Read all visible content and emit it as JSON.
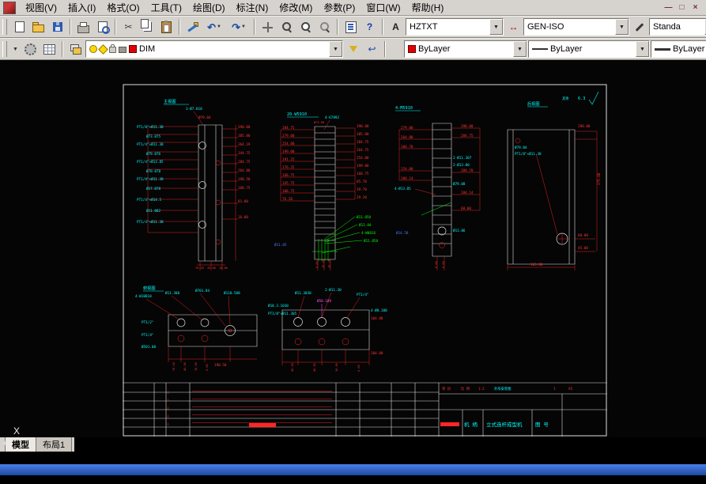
{
  "window": {
    "min": "—",
    "restore": "□",
    "close": "×"
  },
  "menu": {
    "items": [
      "视图(V)",
      "插入(I)",
      "格式(O)",
      "工具(T)",
      "绘图(D)",
      "标注(N)",
      "修改(M)",
      "参数(P)",
      "窗口(W)",
      "帮助(H)"
    ]
  },
  "icons": {
    "cut": "✂",
    "undo": "↶",
    "redo": "↷",
    "help": "?",
    "text_style": "A",
    "dim_style": "↔",
    "arrow_down": "▼",
    "overflow": "▼",
    "layer_prev": "↩"
  },
  "toolbar1": {
    "text_style_value": "HZTXT",
    "dim_style_value": "GEN-ISO",
    "table_style_value": "Standa"
  },
  "toolbar2": {
    "layer_value": "DIM",
    "color_value": "ByLayer",
    "linetype_value": "ByLayer",
    "lineweight_value": "ByLayer"
  },
  "tabs": {
    "model": "模型",
    "layout1": "布局1"
  },
  "ucs": {
    "x": "X",
    "cross": "+"
  },
  "drawing": {
    "titles": {
      "va": "主视图",
      "vb": "20-W5910",
      "vb2": "4-67892",
      "vc": "4-M5910",
      "vd": "后视图",
      "ve": "俯视图",
      "rough": "6.3",
      "rough_note": "其余"
    },
    "va": {
      "top1": "3-Ø7.010",
      "top2": "Ø79.04",
      "l1": "PT1/8\"×Ø11.38",
      "l2": "Ø73.075",
      "l3": "PT1/4\"×Ø11.38",
      "l4": "Ø79.076",
      "l5": "PT1/4\"×Ø13.85",
      "l6": "Ø70.078",
      "l7": "PT1/8\"×Ø11.38",
      "l8": "Ø17.078",
      "l9": "PT1/4\"×Ø14.5",
      "l10": "Ø11.082",
      "l11": "PT1/4\"×Ø11.38",
      "r1": "390.00",
      "r2": "385.80",
      "r3": "364.19",
      "r4": "344.75",
      "r5": "284.75",
      "r6": "264.00",
      "r7": "198.50",
      "r8": "168.75",
      "r9": "81.00",
      "r10": "16.00",
      "b1": "76.20",
      "b2": "45.00",
      "b3": "16.00"
    },
    "vb": {
      "top1": "Ø73.00",
      "l1": "284.75",
      "l2": "279.00",
      "l3": "254.00",
      "l4": "199.00",
      "l5": "191.25",
      "l6": "176.25",
      "l7": "168.75",
      "l8": "145.75",
      "l9": "108.75",
      "l10": "76.20",
      "r1": "390.00",
      "r2": "385.80",
      "r3": "284.75",
      "r4": "264.75",
      "r5": "254.00",
      "r6": "199.00",
      "r7": "168.75",
      "r8": "85.70",
      "r9": "39.70",
      "r10": "29.20",
      "g1": "Ø11.050",
      "g2": "Ø11.84",
      "g3": "4-W0816",
      "g4": "Ø11.850",
      "blue1": "Ø11.05",
      "b1": "0.00",
      "b2": "15.20",
      "b3": "39.70"
    },
    "vc": {
      "l1": "279.00",
      "l2": "264.00",
      "l3": "184.70",
      "l4": "154.00",
      "l5": "104.14",
      "c1": "4-Ø13.85",
      "c2": "2-Ø11.307",
      "c3": "2-Ø13.80",
      "c4": "Ø79.08",
      "c5": "Ø11.06",
      "blue1": "Ø14.58",
      "r1": "390.00",
      "r2": "284.75",
      "r3": "184.70",
      "r4": "104.14",
      "r5": "60.00",
      "b1": "8.00",
      "b2": "0.00"
    },
    "vd": {
      "c1": "Ø79.84",
      "c2": "PT1/8\"×Ø11.38",
      "r1": "290.00",
      "r2": "275.00",
      "r3": "60.00",
      "r4": "45.00",
      "b1": "165.00"
    },
    "ve": {
      "t1": "4-W10810",
      "t2": "Ø11.308",
      "t3": "Ø701.84",
      "t4": "Ø110.508",
      "l1": "PT1/2\"",
      "l2": "PT1/4\"",
      "l3": "Ø501.08",
      "b1": "76.20",
      "b2": "45.00",
      "b3": "16.00",
      "b4": "0.00",
      "r1": "190.50"
    },
    "vf": {
      "t1": "Ø11.3038",
      "t2": "2-Ø11.30",
      "t3": "PT1/4\"",
      "m1": "Ø50.109",
      "l1": "Ø18.3.1030",
      "l2": "PT1/8\"×Ø11.305",
      "r1": "4-Ø8.108",
      "r2": "104.08",
      "r3": "104.80",
      "b1": "45.00",
      "b2": "40.00",
      "b3": "10.00",
      "b4": "0.00"
    },
    "tb": {
      "tri": "△",
      "qty_label": "单 份",
      "scale_label": "比 例",
      "scale": "1:2",
      "name": "外形安装图",
      "sheet": "1",
      "size": "A5",
      "part": "机 柄",
      "product": "立式连杆成型机",
      "drawno": "图 号"
    }
  }
}
